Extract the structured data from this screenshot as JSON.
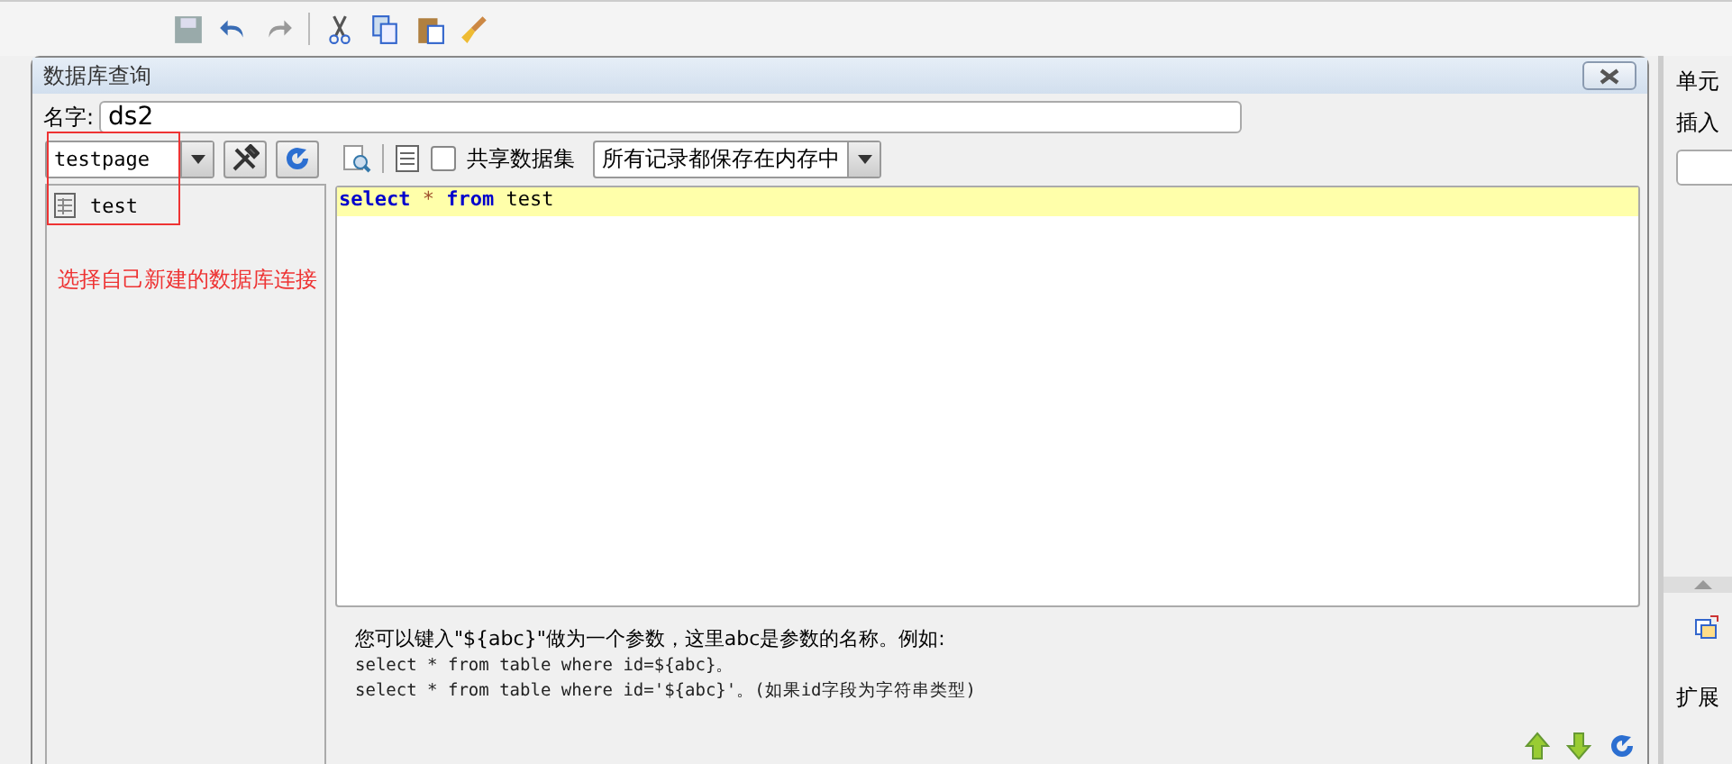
{
  "dialog": {
    "title": "数据库查询",
    "name_label": "名字:",
    "name_value": "ds2"
  },
  "connection": {
    "value": "testpage"
  },
  "tree": {
    "items": [
      {
        "label": "test",
        "selected": false
      }
    ]
  },
  "annotation": {
    "text": "选择自己新建的数据库连接"
  },
  "query_toolbar": {
    "shared": {
      "label": "共享数据集",
      "checked": false
    },
    "storage": {
      "value": "所有记录都保存在内存中"
    }
  },
  "editor": {
    "lines": [
      {
        "tokens": [
          {
            "text": "select",
            "kind": "keyword"
          },
          {
            "text": "*",
            "kind": "operator"
          },
          {
            "text": "from",
            "kind": "keyword"
          },
          {
            "text": "test",
            "kind": "plain"
          }
        ]
      }
    ]
  },
  "help": {
    "lines": [
      {
        "text": "您可以键入\"${abc}\"做为一个参数，这里abc是参数的名称。例如:",
        "kind": "prose"
      },
      {
        "text": "select * from table where id=${abc}。",
        "kind": "code"
      },
      {
        "text": "select * from table where id='${abc}'。(如果id字段为字符串类型)",
        "kind": "code"
      }
    ]
  },
  "side_panel": {
    "labels": [
      "单元",
      "插入"
    ],
    "bottom_label": "扩展"
  }
}
